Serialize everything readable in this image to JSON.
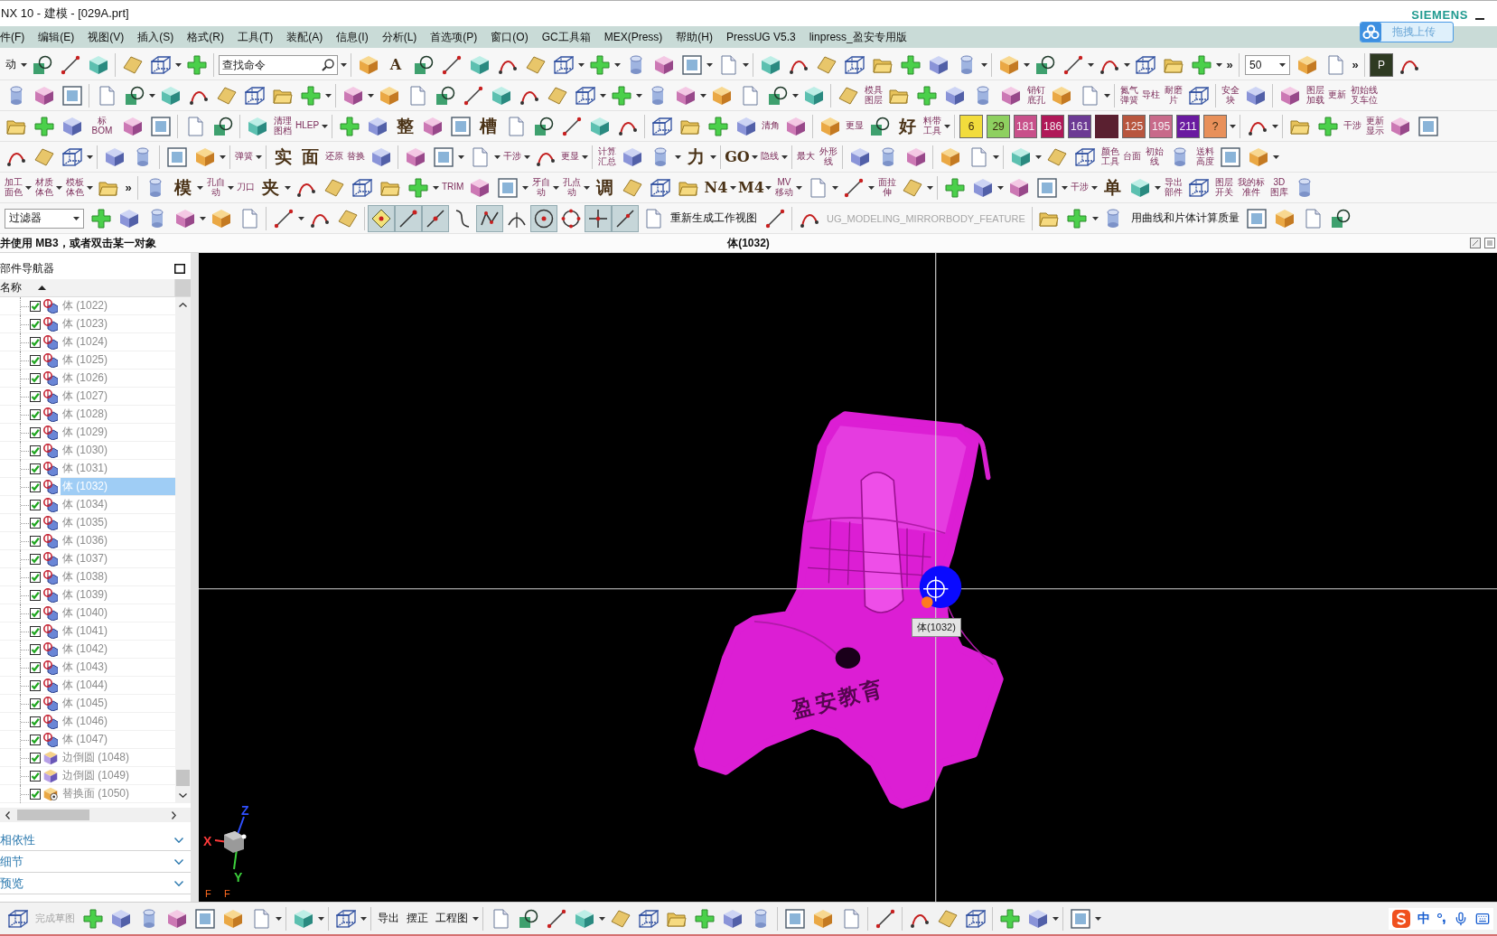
{
  "window": {
    "title": "NX 10 - 建模 - [029A.prt]",
    "brand": "SIEMENS"
  },
  "upload_button": {
    "label": "拖拽上传"
  },
  "menu": [
    "件(F)",
    "编辑(E)",
    "视图(V)",
    "插入(S)",
    "格式(R)",
    "工具(T)",
    "装配(A)",
    "信息(I)",
    "分析(L)",
    "首选项(P)",
    "窗口(O)",
    "GC工具箱",
    "MEX(Press)",
    "帮助(H)",
    "PressUG V5.3",
    "linpress_盈安专用版"
  ],
  "toolbars": [
    {
      "items": [
        {
          "kind": "text",
          "label": "动"
        },
        {
          "kind": "caret"
        },
        {
          "kind": "icon"
        },
        {
          "kind": "icon"
        },
        {
          "kind": "icon"
        },
        {
          "kind": "sep"
        },
        {
          "kind": "icon"
        },
        {
          "kind": "icon"
        },
        {
          "kind": "caret"
        },
        {
          "kind": "icon"
        },
        {
          "kind": "sep"
        },
        {
          "kind": "search",
          "placeholder": "查找命令"
        },
        {
          "kind": "caret"
        },
        {
          "kind": "sep"
        },
        {
          "kind": "icon"
        },
        {
          "kind": "glyph",
          "label": "A"
        },
        {
          "kind": "icon"
        },
        {
          "kind": "icon"
        },
        {
          "kind": "icon"
        },
        {
          "kind": "icon"
        },
        {
          "kind": "icon"
        },
        {
          "kind": "icon"
        },
        {
          "kind": "caret"
        },
        {
          "kind": "icon"
        },
        {
          "kind": "caret"
        },
        {
          "kind": "icon"
        },
        {
          "kind": "icon"
        },
        {
          "kind": "icon"
        },
        {
          "kind": "caret"
        },
        {
          "kind": "icon"
        },
        {
          "kind": "caret"
        },
        {
          "kind": "sep"
        },
        {
          "kind": "icon"
        },
        {
          "kind": "icon"
        },
        {
          "kind": "icon"
        },
        {
          "kind": "icon"
        },
        {
          "kind": "icon"
        },
        {
          "kind": "icon"
        },
        {
          "kind": "icon"
        },
        {
          "kind": "icon"
        },
        {
          "kind": "caret"
        },
        {
          "kind": "sep"
        },
        {
          "kind": "icon"
        },
        {
          "kind": "caret"
        },
        {
          "kind": "icon"
        },
        {
          "kind": "icon"
        },
        {
          "kind": "caret"
        },
        {
          "kind": "icon"
        },
        {
          "kind": "caret"
        },
        {
          "kind": "icon"
        },
        {
          "kind": "icon"
        },
        {
          "kind": "icon"
        },
        {
          "kind": "caret"
        },
        {
          "kind": "more",
          "label": "»"
        },
        {
          "kind": "sep"
        },
        {
          "kind": "select",
          "value": "50"
        },
        {
          "kind": "icon"
        },
        {
          "kind": "icon"
        },
        {
          "kind": "more",
          "label": "»"
        },
        {
          "kind": "sep"
        },
        {
          "kind": "tile",
          "label": "P",
          "color": "#2e3a22"
        },
        {
          "kind": "icon"
        }
      ]
    },
    {
      "items": [
        {
          "kind": "icon"
        },
        {
          "kind": "icon"
        },
        {
          "kind": "icon"
        },
        {
          "kind": "sep"
        },
        {
          "kind": "icon"
        },
        {
          "kind": "icon"
        },
        {
          "kind": "caret"
        },
        {
          "kind": "icon"
        },
        {
          "kind": "icon"
        },
        {
          "kind": "icon"
        },
        {
          "kind": "icon"
        },
        {
          "kind": "icon"
        },
        {
          "kind": "icon"
        },
        {
          "kind": "caret"
        },
        {
          "kind": "sep"
        },
        {
          "kind": "icon"
        },
        {
          "kind": "caret"
        },
        {
          "kind": "icon"
        },
        {
          "kind": "icon"
        },
        {
          "kind": "icon"
        },
        {
          "kind": "icon"
        },
        {
          "kind": "icon"
        },
        {
          "kind": "icon"
        },
        {
          "kind": "icon"
        },
        {
          "kind": "icon"
        },
        {
          "kind": "caret"
        },
        {
          "kind": "icon"
        },
        {
          "kind": "caret"
        },
        {
          "kind": "icon"
        },
        {
          "kind": "icon"
        },
        {
          "kind": "caret"
        },
        {
          "kind": "icon"
        },
        {
          "kind": "icon"
        },
        {
          "kind": "icon"
        },
        {
          "kind": "caret"
        },
        {
          "kind": "icon"
        },
        {
          "kind": "sep"
        },
        {
          "kind": "icon"
        },
        {
          "kind": "label",
          "label": "模具图层"
        },
        {
          "kind": "icon"
        },
        {
          "kind": "icon"
        },
        {
          "kind": "icon"
        },
        {
          "kind": "icon"
        },
        {
          "kind": "icon"
        },
        {
          "kind": "label",
          "label": "销钉底孔"
        },
        {
          "kind": "icon"
        },
        {
          "kind": "icon"
        },
        {
          "kind": "caret"
        },
        {
          "kind": "sep"
        },
        {
          "kind": "label",
          "label": "氮气弹簧"
        },
        {
          "kind": "label",
          "label": "导柱"
        },
        {
          "kind": "label",
          "label": "耐磨片"
        },
        {
          "kind": "icon"
        },
        {
          "kind": "sep"
        },
        {
          "kind": "label",
          "label": "安全块"
        },
        {
          "kind": "icon"
        },
        {
          "kind": "sep"
        },
        {
          "kind": "icon"
        },
        {
          "kind": "label",
          "label": "图层加载"
        },
        {
          "kind": "label",
          "label": "更新"
        },
        {
          "kind": "label",
          "label": "初始线叉车位"
        }
      ]
    },
    {
      "items": [
        {
          "kind": "icon"
        },
        {
          "kind": "icon"
        },
        {
          "kind": "icon"
        },
        {
          "kind": "label",
          "label": "标 BOM"
        },
        {
          "kind": "icon"
        },
        {
          "kind": "icon"
        },
        {
          "kind": "sep"
        },
        {
          "kind": "icon"
        },
        {
          "kind": "icon"
        },
        {
          "kind": "sep"
        },
        {
          "kind": "icon"
        },
        {
          "kind": "label",
          "label": "清理图档"
        },
        {
          "kind": "label",
          "label": "HLEP"
        },
        {
          "kind": "caret"
        },
        {
          "kind": "sep"
        },
        {
          "kind": "icon"
        },
        {
          "kind": "icon"
        },
        {
          "kind": "glyph",
          "label": "整"
        },
        {
          "kind": "icon"
        },
        {
          "kind": "icon"
        },
        {
          "kind": "glyph",
          "label": "槽"
        },
        {
          "kind": "icon"
        },
        {
          "kind": "icon"
        },
        {
          "kind": "icon"
        },
        {
          "kind": "icon"
        },
        {
          "kind": "icon"
        },
        {
          "kind": "sep"
        },
        {
          "kind": "icon"
        },
        {
          "kind": "icon"
        },
        {
          "kind": "icon"
        },
        {
          "kind": "icon"
        },
        {
          "kind": "label",
          "label": "清角"
        },
        {
          "kind": "icon"
        },
        {
          "kind": "sep"
        },
        {
          "kind": "icon"
        },
        {
          "kind": "label",
          "label": "更显"
        },
        {
          "kind": "icon"
        },
        {
          "kind": "glyph",
          "label": "好"
        },
        {
          "kind": "label",
          "label": "料带工具"
        },
        {
          "kind": "caret"
        },
        {
          "kind": "sep"
        },
        {
          "kind": "tile",
          "label": "6",
          "color": "#f2dc3c"
        },
        {
          "kind": "tile",
          "label": "29",
          "color": "#8ed060"
        },
        {
          "kind": "tile",
          "label": "181",
          "color": "#c8508a"
        },
        {
          "kind": "tile",
          "label": "186",
          "color": "#b01858"
        },
        {
          "kind": "tile",
          "label": "161",
          "color": "#6c3a94"
        },
        {
          "kind": "swatch",
          "color": "#5a2030"
        },
        {
          "kind": "tile",
          "label": "125",
          "color": "#b8563e"
        },
        {
          "kind": "tile",
          "label": "195",
          "color": "#c86a8a"
        },
        {
          "kind": "tile",
          "label": "211",
          "color": "#6a1aa0"
        },
        {
          "kind": "tile",
          "label": "?",
          "color": "#e8905a"
        },
        {
          "kind": "caret"
        },
        {
          "kind": "sep"
        },
        {
          "kind": "icon"
        },
        {
          "kind": "caret"
        },
        {
          "kind": "sep"
        },
        {
          "kind": "icon"
        },
        {
          "kind": "icon"
        },
        {
          "kind": "label",
          "label": "干涉"
        },
        {
          "kind": "label",
          "label": "更新显示"
        },
        {
          "kind": "icon"
        },
        {
          "kind": "icon"
        }
      ]
    },
    {
      "items": [
        {
          "kind": "icon"
        },
        {
          "kind": "icon"
        },
        {
          "kind": "icon"
        },
        {
          "kind": "caret"
        },
        {
          "kind": "sep"
        },
        {
          "kind": "icon"
        },
        {
          "kind": "icon"
        },
        {
          "kind": "sep"
        },
        {
          "kind": "icon"
        },
        {
          "kind": "icon"
        },
        {
          "kind": "caret"
        },
        {
          "kind": "sep"
        },
        {
          "kind": "label",
          "label": "弹簧"
        },
        {
          "kind": "caret"
        },
        {
          "kind": "sep"
        },
        {
          "kind": "glyph",
          "label": "实"
        },
        {
          "kind": "glyph",
          "label": "面"
        },
        {
          "kind": "label",
          "label": "还原"
        },
        {
          "kind": "label",
          "label": "替换"
        },
        {
          "kind": "icon"
        },
        {
          "kind": "sep"
        },
        {
          "kind": "icon"
        },
        {
          "kind": "icon"
        },
        {
          "kind": "caret"
        },
        {
          "kind": "icon"
        },
        {
          "kind": "caret"
        },
        {
          "kind": "label",
          "label": "干涉"
        },
        {
          "kind": "caret"
        },
        {
          "kind": "icon"
        },
        {
          "kind": "label",
          "label": "更显"
        },
        {
          "kind": "caret"
        },
        {
          "kind": "sep"
        },
        {
          "kind": "label",
          "label": "计算汇总"
        },
        {
          "kind": "icon"
        },
        {
          "kind": "icon"
        },
        {
          "kind": "caret"
        },
        {
          "kind": "glyph",
          "label": "力"
        },
        {
          "kind": "caret"
        },
        {
          "kind": "sep"
        },
        {
          "kind": "glyph",
          "label": "GO"
        },
        {
          "kind": "caret"
        },
        {
          "kind": "label",
          "label": "隐线"
        },
        {
          "kind": "caret"
        },
        {
          "kind": "sep"
        },
        {
          "kind": "label",
          "label": "最大"
        },
        {
          "kind": "label",
          "label": "外形线"
        },
        {
          "kind": "sep"
        },
        {
          "kind": "icon"
        },
        {
          "kind": "icon"
        },
        {
          "kind": "icon"
        },
        {
          "kind": "sep"
        },
        {
          "kind": "icon"
        },
        {
          "kind": "icon"
        },
        {
          "kind": "caret"
        },
        {
          "kind": "sep"
        },
        {
          "kind": "icon"
        },
        {
          "kind": "caret"
        },
        {
          "kind": "icon"
        },
        {
          "kind": "icon"
        },
        {
          "kind": "label",
          "label": "颜色工具"
        },
        {
          "kind": "label",
          "label": "台面"
        },
        {
          "kind": "label",
          "label": "初始线"
        },
        {
          "kind": "icon"
        },
        {
          "kind": "label",
          "label": "送料高度"
        },
        {
          "kind": "icon"
        },
        {
          "kind": "icon"
        },
        {
          "kind": "caret"
        }
      ]
    },
    {
      "items": [
        {
          "kind": "label",
          "label": "加工面色"
        },
        {
          "kind": "caret"
        },
        {
          "kind": "label",
          "label": "材质体色"
        },
        {
          "kind": "caret"
        },
        {
          "kind": "label",
          "label": "模板体色"
        },
        {
          "kind": "caret"
        },
        {
          "kind": "icon"
        },
        {
          "kind": "more",
          "label": "»"
        },
        {
          "kind": "sep"
        },
        {
          "kind": "icon"
        },
        {
          "kind": "glyph",
          "label": "模"
        },
        {
          "kind": "caret"
        },
        {
          "kind": "label",
          "label": "孔自动"
        },
        {
          "kind": "caret"
        },
        {
          "kind": "label",
          "label": "刀口"
        },
        {
          "kind": "glyph",
          "label": "夹"
        },
        {
          "kind": "caret"
        },
        {
          "kind": "icon"
        },
        {
          "kind": "icon"
        },
        {
          "kind": "icon"
        },
        {
          "kind": "icon"
        },
        {
          "kind": "icon"
        },
        {
          "kind": "caret"
        },
        {
          "kind": "label",
          "label": "TRIM"
        },
        {
          "kind": "icon"
        },
        {
          "kind": "icon"
        },
        {
          "kind": "caret"
        },
        {
          "kind": "label",
          "label": "牙自动"
        },
        {
          "kind": "caret"
        },
        {
          "kind": "label",
          "label": "孔点动"
        },
        {
          "kind": "caret"
        },
        {
          "kind": "glyph",
          "label": "调"
        },
        {
          "kind": "icon"
        },
        {
          "kind": "icon"
        },
        {
          "kind": "icon"
        },
        {
          "kind": "glyph",
          "label": "N4"
        },
        {
          "kind": "caret"
        },
        {
          "kind": "glyph",
          "label": "M4"
        },
        {
          "kind": "caret"
        },
        {
          "kind": "label",
          "label": "MV移动"
        },
        {
          "kind": "caret"
        },
        {
          "kind": "icon"
        },
        {
          "kind": "caret"
        },
        {
          "kind": "icon"
        },
        {
          "kind": "caret"
        },
        {
          "kind": "label",
          "label": "面拉伸"
        },
        {
          "kind": "icon"
        },
        {
          "kind": "caret"
        },
        {
          "kind": "sep"
        },
        {
          "kind": "icon"
        },
        {
          "kind": "icon"
        },
        {
          "kind": "caret"
        },
        {
          "kind": "icon"
        },
        {
          "kind": "icon"
        },
        {
          "kind": "caret"
        },
        {
          "kind": "label",
          "label": "干涉"
        },
        {
          "kind": "caret"
        },
        {
          "kind": "glyph",
          "label": "单"
        },
        {
          "kind": "icon"
        },
        {
          "kind": "caret"
        },
        {
          "kind": "label",
          "label": "导出部件"
        },
        {
          "kind": "icon"
        },
        {
          "kind": "label",
          "label": "图层开关"
        },
        {
          "kind": "label",
          "label": "我的标准件"
        },
        {
          "kind": "label",
          "label": "3D图库"
        },
        {
          "kind": "icon"
        }
      ]
    }
  ],
  "selection_bar": {
    "filter": {
      "value": "过滤器"
    },
    "tools": [
      {
        "kind": "icon"
      },
      {
        "kind": "icon"
      },
      {
        "kind": "icon"
      },
      {
        "kind": "icon"
      },
      {
        "kind": "caret"
      },
      {
        "kind": "icon"
      },
      {
        "kind": "icon"
      },
      {
        "kind": "sep"
      },
      {
        "kind": "icon"
      },
      {
        "kind": "caret"
      },
      {
        "kind": "icon"
      },
      {
        "kind": "icon"
      },
      {
        "kind": "sep"
      }
    ],
    "snap_points": [
      {
        "on": true
      },
      {
        "on": true
      },
      {
        "on": true
      },
      {
        "on": false
      },
      {
        "on": true
      },
      {
        "on": false
      },
      {
        "on": true
      },
      {
        "on": false
      },
      {
        "on": true
      },
      {
        "on": true
      }
    ],
    "commands": [
      {
        "kind": "icon"
      },
      {
        "kind": "text",
        "label": "重新生成工作视图"
      },
      {
        "kind": "icon"
      },
      {
        "kind": "sep"
      },
      {
        "kind": "icon"
      },
      {
        "kind": "dim-text",
        "label": "UG_MODELING_MIRRORBODY_FEATURE"
      },
      {
        "kind": "sep"
      },
      {
        "kind": "icon"
      },
      {
        "kind": "icon"
      },
      {
        "kind": "caret"
      },
      {
        "kind": "icon"
      },
      {
        "kind": "text",
        "label": "用曲线和片体计算质量"
      },
      {
        "kind": "icon"
      },
      {
        "kind": "icon"
      },
      {
        "kind": "icon"
      },
      {
        "kind": "icon"
      }
    ]
  },
  "cue_line": {
    "prompt": "并使用 MB3，或者双击某一对象",
    "selection": "体(1032)"
  },
  "navigator": {
    "title": "部件导航器",
    "column": "名称",
    "items": [
      {
        "kind": "body",
        "label": "体 (1022)",
        "checked": true,
        "selected": false
      },
      {
        "kind": "body",
        "label": "体 (1023)",
        "checked": true,
        "selected": false
      },
      {
        "kind": "body",
        "label": "体 (1024)",
        "checked": true,
        "selected": false
      },
      {
        "kind": "body",
        "label": "体 (1025)",
        "checked": true,
        "selected": false
      },
      {
        "kind": "body",
        "label": "体 (1026)",
        "checked": true,
        "selected": false
      },
      {
        "kind": "body",
        "label": "体 (1027)",
        "checked": true,
        "selected": false
      },
      {
        "kind": "body",
        "label": "体 (1028)",
        "checked": true,
        "selected": false
      },
      {
        "kind": "body",
        "label": "体 (1029)",
        "checked": true,
        "selected": false
      },
      {
        "kind": "body",
        "label": "体 (1030)",
        "checked": true,
        "selected": false
      },
      {
        "kind": "body",
        "label": "体 (1031)",
        "checked": true,
        "selected": false
      },
      {
        "kind": "body",
        "label": "体 (1032)",
        "checked": true,
        "selected": true
      },
      {
        "kind": "body",
        "label": "体 (1034)",
        "checked": true,
        "selected": false
      },
      {
        "kind": "body",
        "label": "体 (1035)",
        "checked": true,
        "selected": false
      },
      {
        "kind": "body",
        "label": "体 (1036)",
        "checked": true,
        "selected": false
      },
      {
        "kind": "body",
        "label": "体 (1037)",
        "checked": true,
        "selected": false
      },
      {
        "kind": "body",
        "label": "体 (1038)",
        "checked": true,
        "selected": false
      },
      {
        "kind": "body",
        "label": "体 (1039)",
        "checked": true,
        "selected": false
      },
      {
        "kind": "body",
        "label": "体 (1040)",
        "checked": true,
        "selected": false
      },
      {
        "kind": "body",
        "label": "体 (1041)",
        "checked": true,
        "selected": false
      },
      {
        "kind": "body",
        "label": "体 (1042)",
        "checked": true,
        "selected": false
      },
      {
        "kind": "body",
        "label": "体 (1043)",
        "checked": true,
        "selected": false
      },
      {
        "kind": "body",
        "label": "体 (1044)",
        "checked": true,
        "selected": false
      },
      {
        "kind": "body",
        "label": "体 (1045)",
        "checked": true,
        "selected": false
      },
      {
        "kind": "body",
        "label": "体 (1046)",
        "checked": true,
        "selected": false
      },
      {
        "kind": "body",
        "label": "体 (1047)",
        "checked": true,
        "selected": false
      },
      {
        "kind": "edge-blend",
        "label": "边倒圆 (1048)",
        "checked": true,
        "selected": false
      },
      {
        "kind": "edge-blend",
        "label": "边倒圆 (1049)",
        "checked": true,
        "selected": false
      },
      {
        "kind": "replace-face",
        "label": "替换面 (1050)",
        "checked": true,
        "selected": false
      }
    ]
  },
  "panels": [
    {
      "label": "相依性",
      "expanded": false
    },
    {
      "label": "细节",
      "expanded": false
    },
    {
      "label": "预览",
      "expanded": false
    }
  ],
  "viewport": {
    "tooltip": "体(1032)",
    "engraving": "盈安教育",
    "triad": [
      {
        "label": "Z",
        "color": "#3050ff"
      },
      {
        "label": "X",
        "color": "#ff3a3a"
      },
      {
        "label": "Y",
        "color": "#3cd03c"
      }
    ],
    "view_marks": [
      "F",
      "F"
    ]
  },
  "bottom_toolbar": {
    "items": [
      {
        "kind": "icon"
      },
      {
        "kind": "dim-text",
        "label": "完成草图"
      },
      {
        "kind": "icon"
      },
      {
        "kind": "icon"
      },
      {
        "kind": "icon"
      },
      {
        "kind": "icon"
      },
      {
        "kind": "icon"
      },
      {
        "kind": "icon"
      },
      {
        "kind": "icon"
      },
      {
        "kind": "caret"
      },
      {
        "kind": "sep"
      },
      {
        "kind": "icon"
      },
      {
        "kind": "caret"
      },
      {
        "kind": "sep"
      },
      {
        "kind": "icon"
      },
      {
        "kind": "caret"
      },
      {
        "kind": "sep"
      },
      {
        "kind": "text",
        "label": "导出"
      },
      {
        "kind": "text",
        "label": "摆正"
      },
      {
        "kind": "text",
        "label": "工程图"
      },
      {
        "kind": "caret"
      },
      {
        "kind": "sep"
      },
      {
        "kind": "icon"
      },
      {
        "kind": "icon"
      },
      {
        "kind": "icon"
      },
      {
        "kind": "icon"
      },
      {
        "kind": "caret"
      },
      {
        "kind": "icon"
      },
      {
        "kind": "icon"
      },
      {
        "kind": "icon"
      },
      {
        "kind": "icon"
      },
      {
        "kind": "icon"
      },
      {
        "kind": "icon"
      },
      {
        "kind": "sep"
      },
      {
        "kind": "icon"
      },
      {
        "kind": "icon"
      },
      {
        "kind": "icon"
      },
      {
        "kind": "sep"
      },
      {
        "kind": "icon"
      },
      {
        "kind": "sep"
      },
      {
        "kind": "icon"
      },
      {
        "kind": "icon"
      },
      {
        "kind": "icon"
      },
      {
        "kind": "sep"
      },
      {
        "kind": "icon"
      },
      {
        "kind": "icon"
      },
      {
        "kind": "caret"
      },
      {
        "kind": "sep"
      },
      {
        "kind": "icon"
      },
      {
        "kind": "caret"
      }
    ],
    "ime": {
      "mode": "中"
    }
  }
}
